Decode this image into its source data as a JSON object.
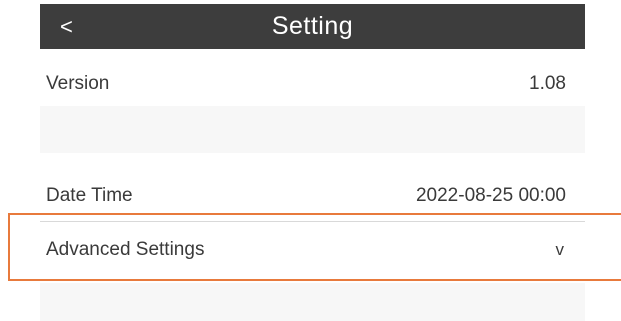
{
  "header": {
    "back_label": "<",
    "title": "Setting"
  },
  "rows": {
    "version": {
      "label": "Version",
      "value": "1.08"
    },
    "date_time": {
      "label": "Date Time",
      "value": "2022-08-25 00:00"
    },
    "advanced": {
      "label": "Advanced Settings",
      "value": "v"
    }
  },
  "colors": {
    "header_bg": "#3d3d3d",
    "highlight": "#e87a3c",
    "band_bg": "#f7f7f7"
  }
}
